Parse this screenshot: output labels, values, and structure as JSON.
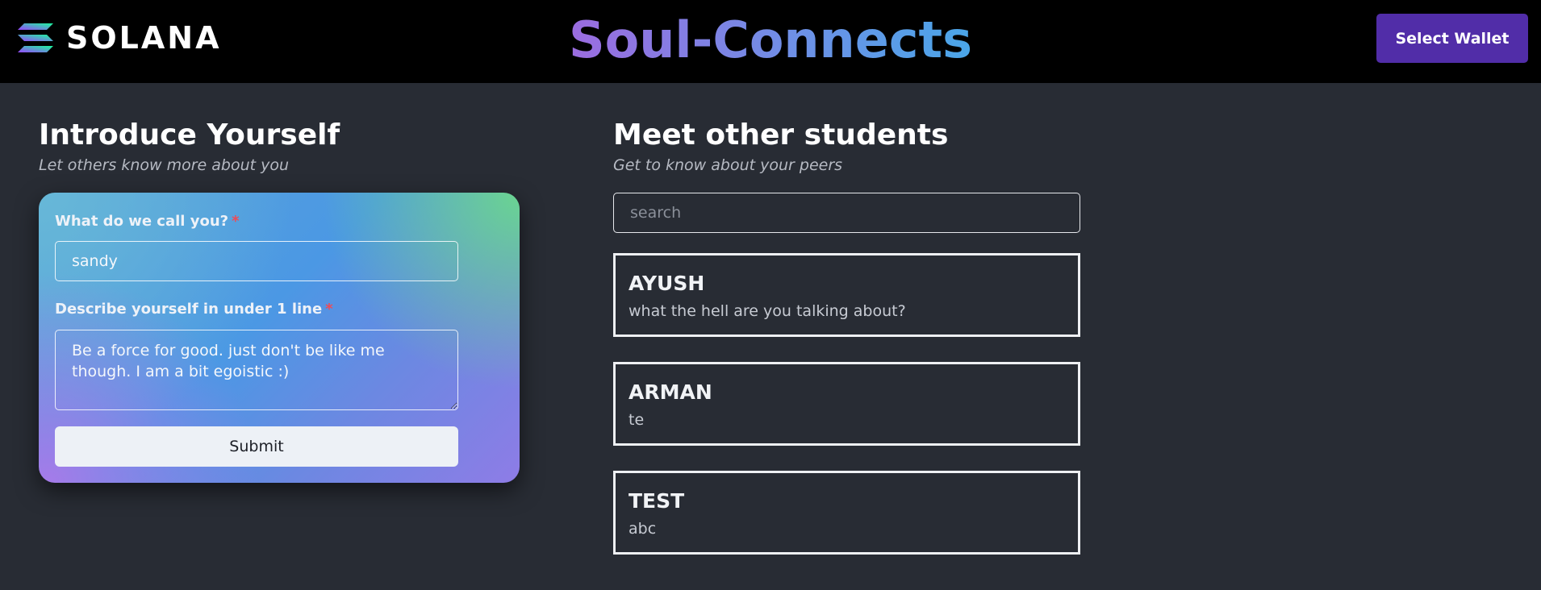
{
  "header": {
    "logo_text": "SOLANA",
    "title": "Soul-Connects",
    "wallet_button": "Select Wallet"
  },
  "intro": {
    "heading": "Introduce Yourself",
    "subheading": "Let others know more about you",
    "name_label": "What do we call you?",
    "name_value": "sandy",
    "bio_label": "Describe yourself in under 1 line",
    "bio_value": "Be a force for good. just don't be like me though. I am a bit egoistic :)",
    "required_marker": "*",
    "submit_label": "Submit"
  },
  "students": {
    "heading": "Meet other students",
    "subheading": "Get to know about your peers",
    "search_placeholder": "search",
    "items": [
      {
        "name": "AYUSH",
        "bio": "what the hell are you talking about?"
      },
      {
        "name": "ARMAN",
        "bio": "te"
      },
      {
        "name": "TEST",
        "bio": "abc"
      }
    ]
  },
  "colors": {
    "page_background": "#282c34",
    "header_background": "#000000",
    "wallet_button": "#512da8",
    "required": "#f04a55"
  },
  "icons": {
    "logo": "solana-logo-icon",
    "textarea_resize": "resize-handle-icon"
  }
}
